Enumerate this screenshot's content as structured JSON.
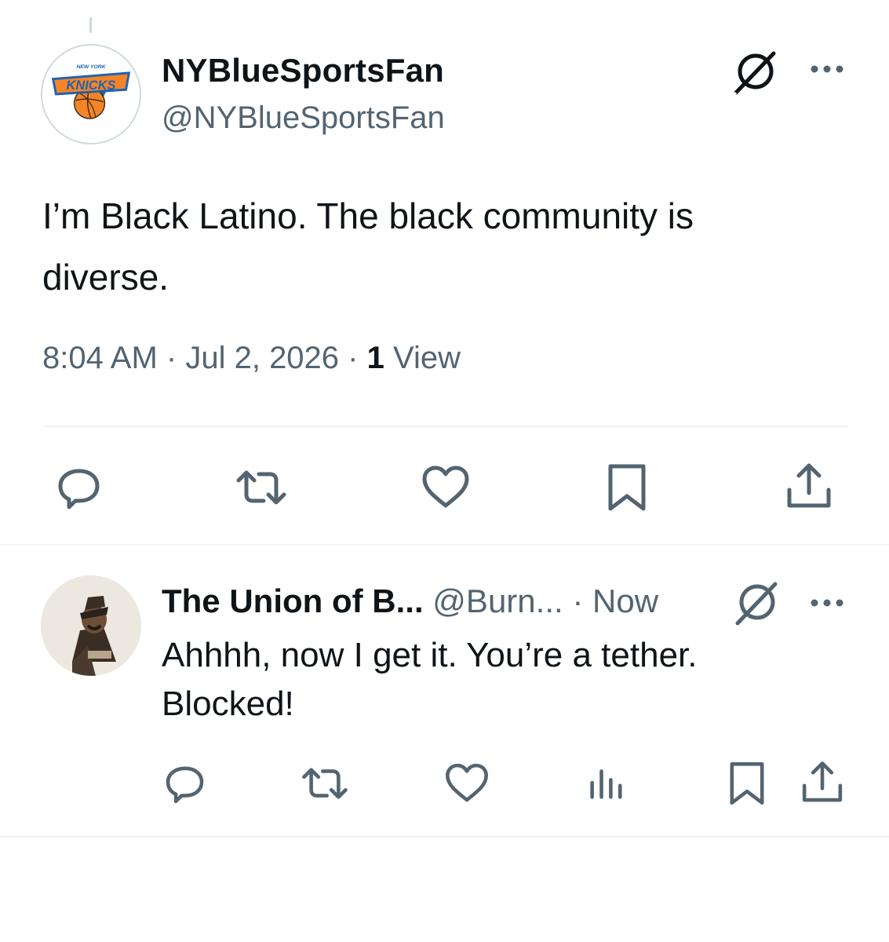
{
  "tweet": {
    "author": {
      "display_name": "NYBlueSportsFan",
      "handle": "@NYBlueSportsFan",
      "avatar_icon": "knicks-logo-avatar",
      "logo_text_top": "NEW YORK",
      "logo_text_main": "KNICKS"
    },
    "text": "I’m Black Latino. The black community is\ndiverse.",
    "meta": {
      "time": "8:04 AM",
      "separator": "·",
      "date": "Jul 2, 2026",
      "views_count": "1",
      "views_label": "View"
    },
    "actions": [
      {
        "name": "reply",
        "icon": "reply-icon"
      },
      {
        "name": "repost",
        "icon": "repost-icon"
      },
      {
        "name": "like",
        "icon": "heart-icon"
      },
      {
        "name": "bookmark",
        "icon": "bookmark-icon"
      },
      {
        "name": "share",
        "icon": "share-icon"
      }
    ]
  },
  "reply": {
    "author": {
      "display_name": "The Union of B...",
      "handle": "@Burn...",
      "avatar_icon": "cowboy-photo-avatar"
    },
    "separator": "·",
    "time": "Now",
    "text": "Ahhhh, now I get it. You’re a tether.\nBlocked!",
    "actions": [
      {
        "name": "reply",
        "icon": "reply-icon"
      },
      {
        "name": "repost",
        "icon": "repost-icon"
      },
      {
        "name": "like",
        "icon": "heart-icon"
      },
      {
        "name": "views",
        "icon": "analytics-icon"
      },
      {
        "name": "bookmark",
        "icon": "bookmark-icon"
      },
      {
        "name": "share",
        "icon": "share-icon"
      }
    ]
  },
  "colors": {
    "text_primary": "#0f1419",
    "text_secondary": "#536471",
    "icon": "#536471",
    "divider": "#eff3f4",
    "knicks_blue": "#1d62b3",
    "knicks_orange": "#f58426"
  }
}
